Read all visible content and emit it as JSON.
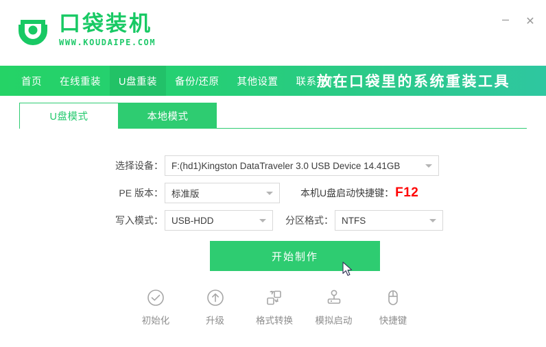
{
  "window": {
    "minimize_label": "–",
    "close_label": "✕"
  },
  "brand": {
    "title": "口袋装机",
    "url": "WWW.KOUDAIPE.COM",
    "logo_icon": "shield-dot-icon",
    "color": "#18c964"
  },
  "nav": {
    "items": [
      {
        "label": "首页",
        "active": false
      },
      {
        "label": "在线重装",
        "active": false
      },
      {
        "label": "U盘重装",
        "active": true
      },
      {
        "label": "备份/还原",
        "active": false
      },
      {
        "label": "其他设置",
        "active": false
      },
      {
        "label": "联系我们",
        "active": false
      }
    ],
    "slogan": "放在口袋里的系统重装工具"
  },
  "tabs": [
    {
      "label": "U盘模式",
      "active": true
    },
    {
      "label": "本地模式",
      "active": false
    }
  ],
  "form": {
    "device": {
      "label": "选择设备：",
      "value": "F:(hd1)Kingston DataTraveler 3.0 USB Device 14.41GB"
    },
    "pe_version": {
      "label": "PE 版本：",
      "value": "标准版"
    },
    "hotkey": {
      "label": "本机U盘启动快捷键：",
      "key": "F12",
      "color": "#ff0000"
    },
    "write_mode": {
      "label": "写入模式：",
      "value": "USB-HDD"
    },
    "partition_format": {
      "label": "分区格式：",
      "value": "NTFS"
    }
  },
  "action": {
    "start_label": "开始制作"
  },
  "tools": [
    {
      "label": "初始化",
      "icon": "check-circle-icon"
    },
    {
      "label": "升级",
      "icon": "arrow-up-circle-icon"
    },
    {
      "label": "格式转换",
      "icon": "convert-squares-icon"
    },
    {
      "label": "模拟启动",
      "icon": "joystick-icon"
    },
    {
      "label": "快捷键",
      "icon": "mouse-icon"
    }
  ],
  "theme": {
    "green": "#2ecc71",
    "nav_gradient_start": "#25d366",
    "nav_gradient_end": "#2ec7a0"
  }
}
